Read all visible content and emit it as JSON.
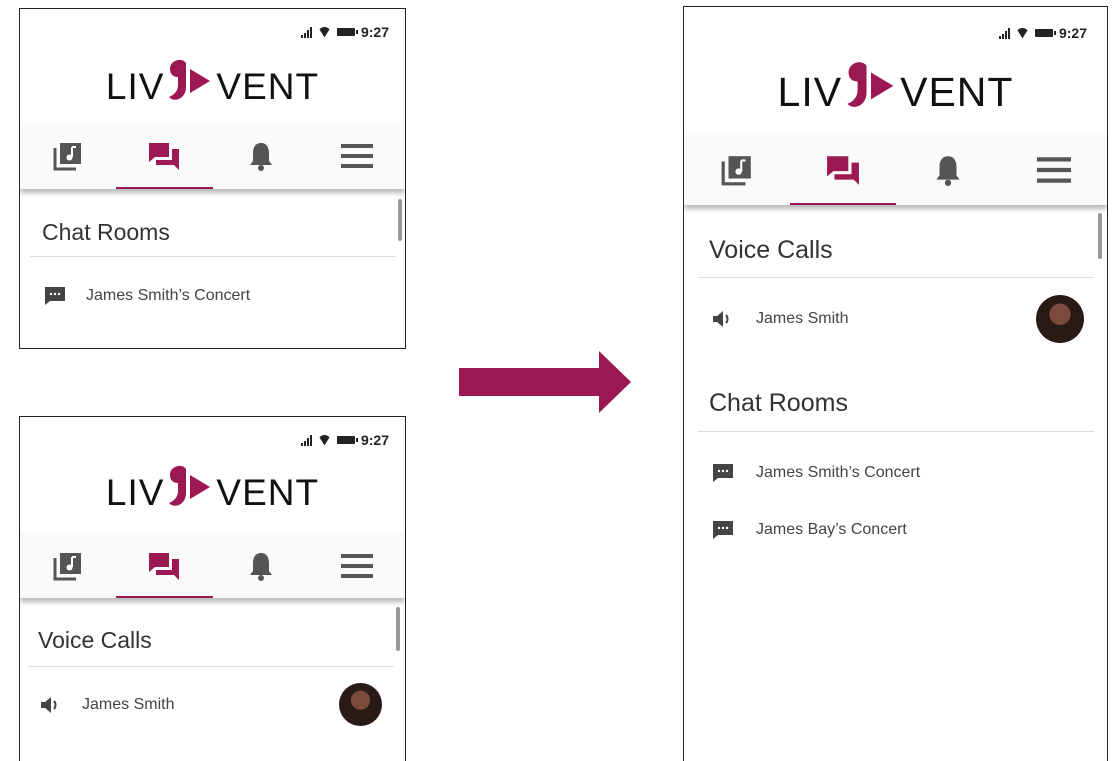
{
  "status_bar": {
    "time": "9:27"
  },
  "logo": {
    "left": "LIV",
    "right": "VENT"
  },
  "tabs": [
    {
      "icon": "music-library-icon"
    },
    {
      "icon": "chat-icon",
      "active": true
    },
    {
      "icon": "bell-icon"
    },
    {
      "icon": "menu-icon"
    }
  ],
  "phone_a": {
    "section": "Chat Rooms",
    "rows": [
      {
        "icon": "message-icon",
        "label": "James Smith’s Concert"
      }
    ]
  },
  "phone_b": {
    "section": "Voice Calls",
    "rows": [
      {
        "icon": "speaker-icon",
        "label": "James Smith"
      }
    ]
  },
  "phone_c": {
    "voice_section": "Voice Calls",
    "voice_rows": [
      {
        "icon": "speaker-icon",
        "label": "James Smith"
      }
    ],
    "chat_section": "Chat Rooms",
    "chat_rows": [
      {
        "icon": "message-icon",
        "label": "James Smith’s Concert"
      },
      {
        "icon": "message-icon",
        "label": "James Bay’s Concert"
      }
    ]
  },
  "colors": {
    "accent": "#9c1853",
    "icon_gray": "#555555"
  }
}
